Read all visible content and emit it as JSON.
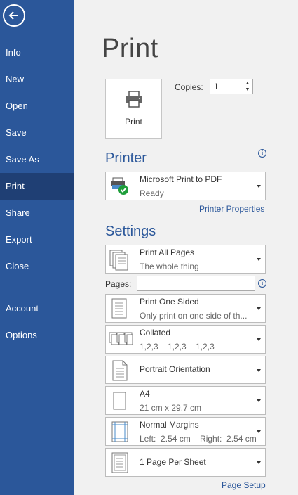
{
  "nav": {
    "items": [
      {
        "label": "Info"
      },
      {
        "label": "New"
      },
      {
        "label": "Open"
      },
      {
        "label": "Save"
      },
      {
        "label": "Save As"
      },
      {
        "label": "Print"
      },
      {
        "label": "Share"
      },
      {
        "label": "Export"
      },
      {
        "label": "Close"
      },
      {
        "label": "Account"
      },
      {
        "label": "Options"
      }
    ],
    "active": "Print"
  },
  "page": {
    "title": "Print"
  },
  "print_button": {
    "label": "Print",
    "icon": "printer-icon"
  },
  "copies": {
    "label": "Copies:",
    "value": "1"
  },
  "printer": {
    "section_title": "Printer",
    "name": "Microsoft Print to PDF",
    "status": "Ready",
    "properties_link": "Printer Properties"
  },
  "settings": {
    "section_title": "Settings",
    "print_range": {
      "title": "Print All Pages",
      "subtitle": "The whole thing"
    },
    "pages_label": "Pages:",
    "pages_value": "",
    "sides": {
      "title": "Print One Sided",
      "subtitle": "Only print on one side of th..."
    },
    "collation": {
      "title": "Collated",
      "subtitle": "1,2,3    1,2,3    1,2,3"
    },
    "orientation": {
      "title": "Portrait Orientation"
    },
    "paper": {
      "title": "A4",
      "subtitle": "21 cm x 29.7 cm"
    },
    "margins": {
      "title": "Normal Margins",
      "subtitle": "Left:  2.54 cm    Right:  2.54 cm"
    },
    "per_sheet": {
      "title": "1 Page Per Sheet"
    },
    "page_setup_link": "Page Setup"
  },
  "colors": {
    "accent": "#2b579a",
    "sidebar": "#2b579a",
    "sidebar_active": "#1f3f74",
    "background": "#f1f1f1"
  }
}
